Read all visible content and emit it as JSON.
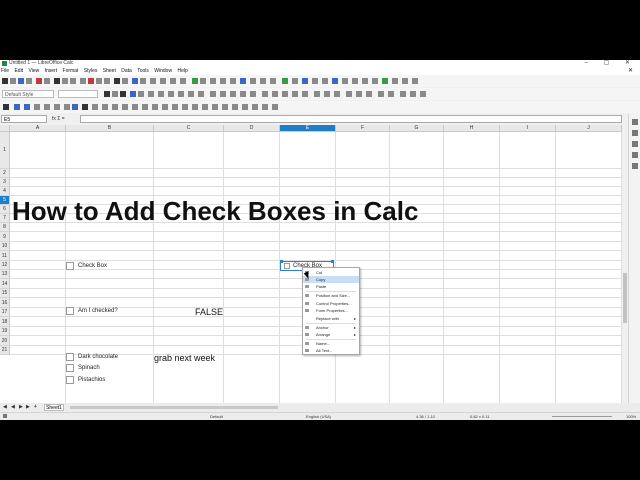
{
  "window": {
    "title": "Untitled 1 — LibreOffice Calc",
    "controls": "–  ▢  ✕"
  },
  "menu": [
    "File",
    "Edit",
    "View",
    "Insert",
    "Format",
    "Styles",
    "Sheet",
    "Data",
    "Tools",
    "Window",
    "Help"
  ],
  "menu_close": "✕",
  "toolbar": {
    "style_combo": "Default Style"
  },
  "formula_bar": {
    "name_box": "E5",
    "fx_label": "fx  Σ  =",
    "content": ""
  },
  "columns": [
    "A",
    "B",
    "C",
    "D",
    "E",
    "F",
    "G",
    "H",
    "I",
    "J"
  ],
  "selected_column": "E",
  "rows": [
    "1",
    "2",
    "3",
    "4",
    "5",
    "6",
    "7",
    "8",
    "9",
    "10",
    "11",
    "12",
    "13",
    "14",
    "15",
    "16",
    "17",
    "18",
    "19",
    "20",
    "21"
  ],
  "selected_row": "5",
  "cells": {
    "title": "How to Add Check Boxes in Calc",
    "false_value": "FALSE",
    "grab_note": "grab next week"
  },
  "checkboxes": [
    {
      "label": "Check Box"
    },
    {
      "label": "Am I checked?"
    },
    {
      "label": "Dark chocolate"
    },
    {
      "label": "Spinach"
    },
    {
      "label": "Pistachios"
    }
  ],
  "selected_control": {
    "label": "Check Box"
  },
  "context_menu": {
    "items": [
      "Cut",
      "Copy",
      "Paste",
      "Position and Size...",
      "Control Properties...",
      "Form Properties...",
      "Replace with",
      "Anchor",
      "Arrange",
      "Name...",
      "Alt Text..."
    ],
    "highlighted": "Copy"
  },
  "tabs": {
    "nav": [
      "◀",
      "◀",
      "▶",
      "▶",
      "+"
    ],
    "active": "Sheet1"
  },
  "status": {
    "page_style": "Default",
    "language": "English (USA)",
    "position": "4.36 / 1.10",
    "size": "0.82 x 0.11",
    "zoom": "100%"
  }
}
